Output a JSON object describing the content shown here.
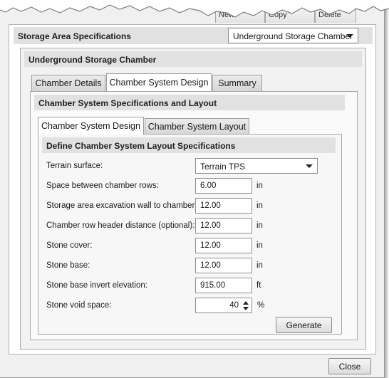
{
  "top_tabs": [
    "New",
    "Copy",
    "Delete"
  ],
  "storage": {
    "title": "Storage Area Specifications",
    "type_select": "Underground Storage Chamber"
  },
  "underground": {
    "title": "Underground Storage Chamber"
  },
  "main_tabs": [
    {
      "label": "Chamber Details"
    },
    {
      "label": "Chamber System Design"
    },
    {
      "label": "Summary"
    }
  ],
  "system": {
    "title": "Chamber System Specifications and Layout"
  },
  "sub_tabs": [
    {
      "label": "Chamber System Design"
    },
    {
      "label": "Chamber System Layout"
    }
  ],
  "layout": {
    "title": "Define Chamber System Layout Specifications",
    "terrain": {
      "label": "Terrain surface:",
      "value": "Terrain TPS"
    },
    "fields": [
      {
        "label": "Space between chamber rows:",
        "value": "6.00",
        "unit": "in"
      },
      {
        "label": "Storage area excavation wall to chambers:",
        "value": "12.00",
        "unit": "in"
      },
      {
        "label": "Chamber row header distance (optional):",
        "value": "12.00",
        "unit": "in"
      },
      {
        "label": "Stone cover:",
        "value": "12.00",
        "unit": "in"
      },
      {
        "label": "Stone base:",
        "value": "12.00",
        "unit": "in"
      },
      {
        "label": "Stone base invert elevation:",
        "value": "915.00",
        "unit": "ft"
      }
    ],
    "void": {
      "label": "Stone void space:",
      "value": "40",
      "unit": "%"
    },
    "generate_label": "Generate"
  },
  "close_label": "Close"
}
